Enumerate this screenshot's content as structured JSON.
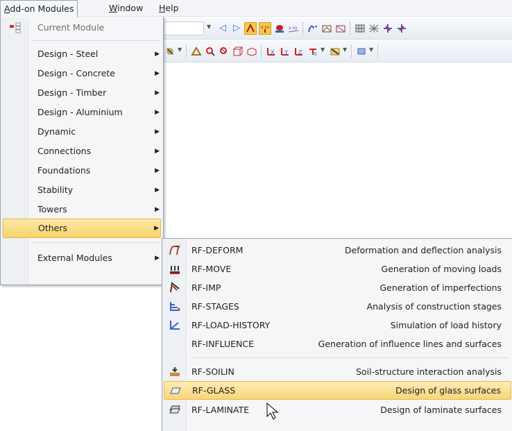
{
  "menubar": {
    "items": [
      {
        "label": "Add-on Modules",
        "accel": "A"
      },
      {
        "label": "Window",
        "accel": "W"
      },
      {
        "label": "Help",
        "accel": "H"
      }
    ]
  },
  "addon_menu": {
    "current_module": "Current Module",
    "items": [
      {
        "label": "Design - Steel"
      },
      {
        "label": "Design - Concrete"
      },
      {
        "label": "Design - Timber"
      },
      {
        "label": "Design - Aluminium"
      },
      {
        "label": "Dynamic"
      },
      {
        "label": "Connections"
      },
      {
        "label": "Foundations"
      },
      {
        "label": "Stability"
      },
      {
        "label": "Towers"
      },
      {
        "label": "Others"
      }
    ],
    "external": "External Modules"
  },
  "others_submenu": {
    "items": [
      {
        "name": "RF-DEFORM",
        "desc": "Deformation and deflection analysis"
      },
      {
        "name": "RF-MOVE",
        "desc": "Generation of moving loads"
      },
      {
        "name": "RF-IMP",
        "desc": "Generation of imperfections"
      },
      {
        "name": "RF-STAGES",
        "desc": "Analysis of construction stages"
      },
      {
        "name": "RF-LOAD-HISTORY",
        "desc": "Simulation of load history"
      },
      {
        "name": "RF-INFLUENCE",
        "desc": "Generation of influence lines and surfaces"
      },
      {
        "name": "RF-SOILIN",
        "desc": "Soil-structure interaction analysis"
      },
      {
        "name": "RF-GLASS",
        "desc": "Design of glass surfaces"
      },
      {
        "name": "RF-LAMINATE",
        "desc": "Design of laminate surfaces"
      }
    ]
  },
  "colors": {
    "highlight": "#f8d679",
    "menu_bg": "#f5f6f7",
    "toolbar_bg": "#e7ecf3"
  }
}
